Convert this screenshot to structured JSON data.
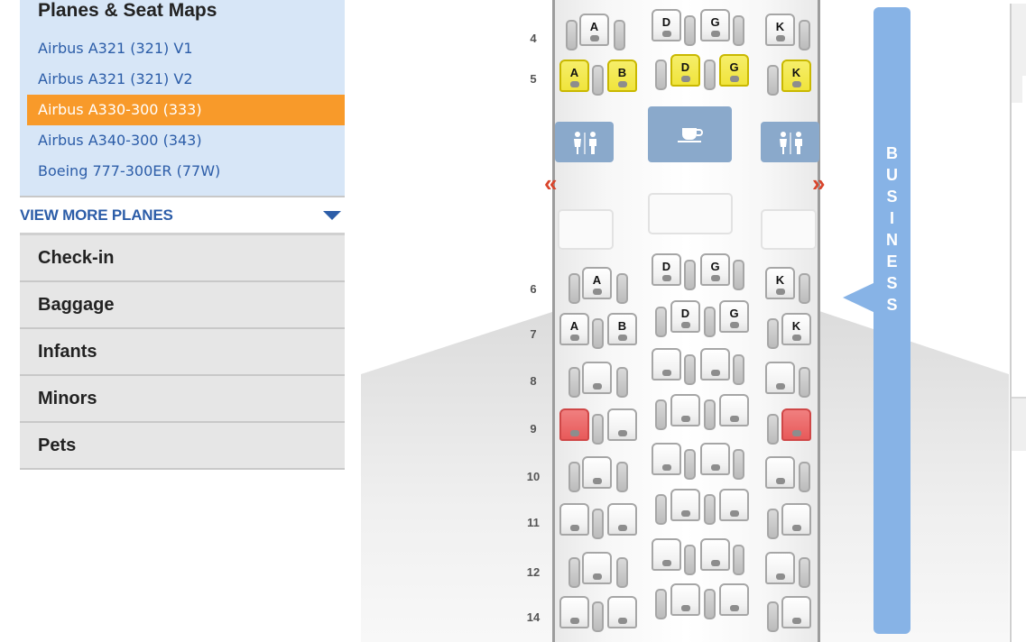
{
  "sidebar": {
    "planes_title": "Planes & Seat Maps",
    "planes": [
      {
        "label": "Airbus A321 (321) V1",
        "active": false
      },
      {
        "label": "Airbus A321 (321) V2",
        "active": false
      },
      {
        "label": "Airbus A330-300 (333)",
        "active": true
      },
      {
        "label": "Airbus A340-300 (343)",
        "active": false
      },
      {
        "label": "Boeing 777-300ER (77W)",
        "active": false
      }
    ],
    "view_more_label": "VIEW MORE PLANES",
    "menu": [
      {
        "label": "Check-in"
      },
      {
        "label": "Baggage"
      },
      {
        "label": "Infants"
      },
      {
        "label": "Minors"
      },
      {
        "label": "Pets"
      }
    ]
  },
  "seat_map": {
    "cabin_label": "BUSINESS",
    "rows": [
      {
        "number": "4",
        "seats": [
          {
            "letter": "A",
            "status": "available"
          },
          {
            "letter": "D",
            "status": "available"
          },
          {
            "letter": "G",
            "status": "available"
          },
          {
            "letter": "K",
            "status": "available"
          }
        ]
      },
      {
        "number": "5",
        "seats": [
          {
            "letter": "A",
            "status": "highlighted"
          },
          {
            "letter": "B",
            "status": "highlighted"
          },
          {
            "letter": "D",
            "status": "highlighted"
          },
          {
            "letter": "G",
            "status": "highlighted"
          },
          {
            "letter": "K",
            "status": "highlighted"
          }
        ]
      },
      {
        "number": "6",
        "seats": [
          {
            "letter": "A",
            "status": "available"
          },
          {
            "letter": "D",
            "status": "available"
          },
          {
            "letter": "G",
            "status": "available"
          },
          {
            "letter": "K",
            "status": "available"
          }
        ]
      },
      {
        "number": "7",
        "seats": [
          {
            "letter": "A",
            "status": "available"
          },
          {
            "letter": "B",
            "status": "available"
          },
          {
            "letter": "D",
            "status": "available"
          },
          {
            "letter": "G",
            "status": "available"
          },
          {
            "letter": "K",
            "status": "available"
          }
        ]
      },
      {
        "number": "8",
        "seats": []
      },
      {
        "number": "9",
        "seats": [
          {
            "letter": "",
            "status": "bad"
          },
          {
            "letter": "",
            "status": "bad"
          }
        ]
      },
      {
        "number": "10",
        "seats": []
      },
      {
        "number": "11",
        "seats": []
      },
      {
        "number": "12",
        "seats": []
      },
      {
        "number": "14",
        "seats": []
      }
    ],
    "facilities": [
      "lavatory-icon",
      "galley-icon",
      "lavatory-icon"
    ],
    "exit_left": "«",
    "exit_right": "»",
    "status_colors": {
      "highlighted": "#f0e43c",
      "bad": "#e85a5a",
      "cabin": "#87b3e6",
      "active_item": "#f89a2a"
    }
  }
}
